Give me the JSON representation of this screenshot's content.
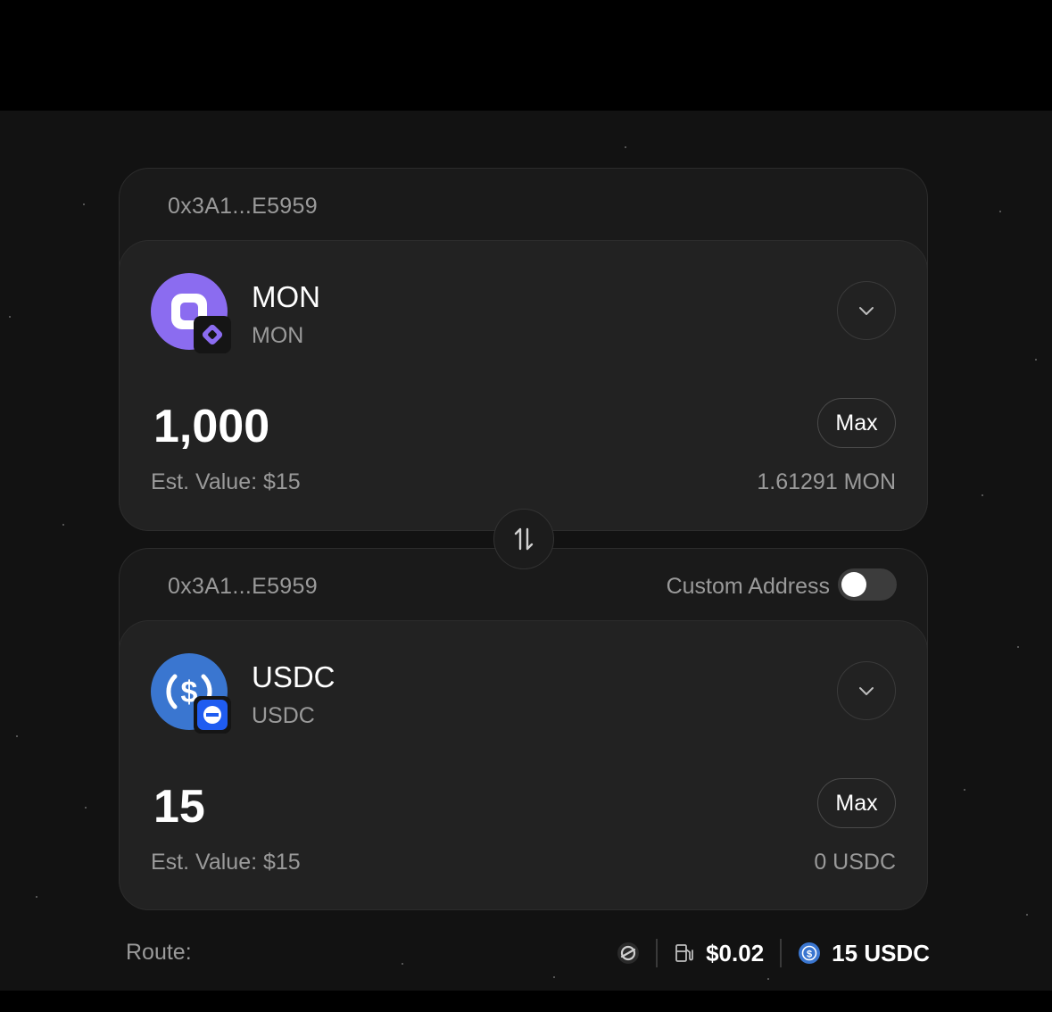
{
  "source": {
    "address": "0x3A1...E5959",
    "token_name": "MON",
    "token_symbol": "MON",
    "amount": "1,000",
    "max_label": "Max",
    "est_value": "Est. Value: $15",
    "balance": "1.61291 MON"
  },
  "destination": {
    "address": "0x3A1...E5959",
    "custom_address_label": "Custom Address",
    "custom_address_enabled": false,
    "token_name": "USDC",
    "token_symbol": "USDC",
    "amount": "15",
    "max_label": "Max",
    "est_value": "Est. Value: $15",
    "balance": "0 USDC"
  },
  "route": {
    "label": "Route:",
    "gas_fee": "$0.02",
    "output": "15 USDC"
  },
  "colors": {
    "mon_purple": "#8b6cf0",
    "usdc_blue": "#3a76d0",
    "background": "#121212",
    "card": "#222222"
  }
}
